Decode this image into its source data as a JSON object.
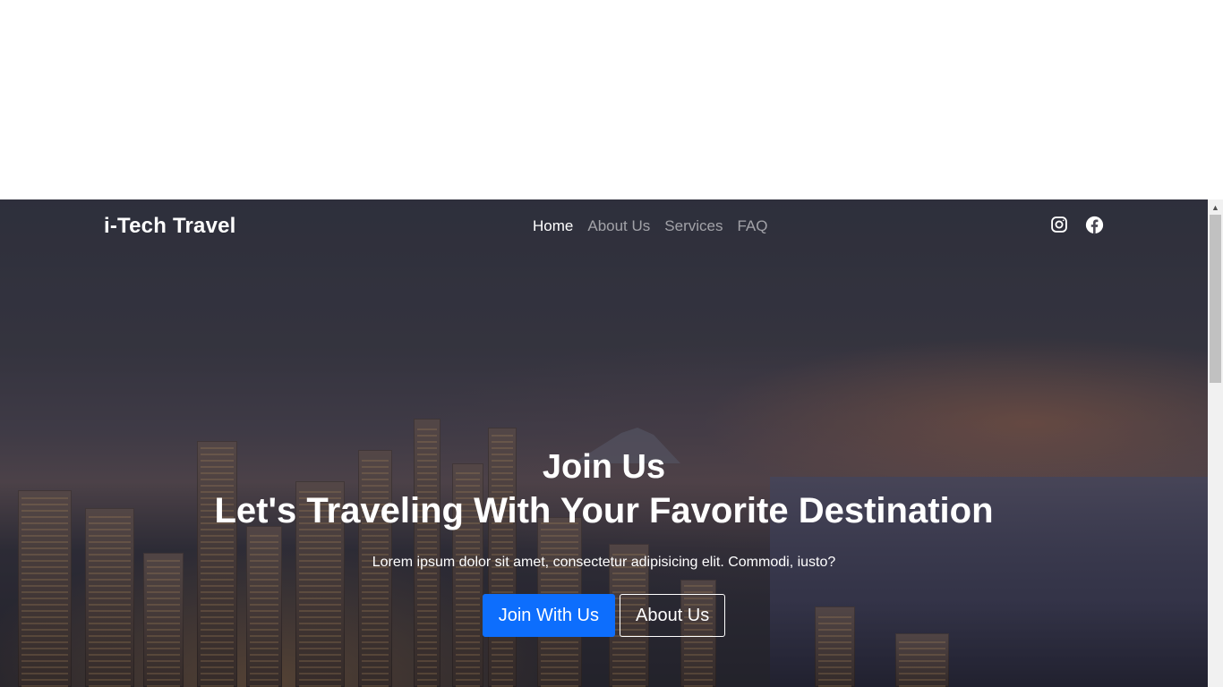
{
  "navbar": {
    "brand": "i-Tech Travel",
    "links": [
      {
        "label": "Home",
        "active": true
      },
      {
        "label": "About Us",
        "active": false
      },
      {
        "label": "Services",
        "active": false
      },
      {
        "label": "FAQ",
        "active": false
      }
    ],
    "social": [
      "instagram-icon",
      "facebook-icon"
    ]
  },
  "hero": {
    "title_line1": "Join Us",
    "title_line2": "Let's Traveling With Your Favorite Destination",
    "subtitle": "Lorem ipsum dolor sit amet, consectetur adipisicing elit. Commodi, iusto?",
    "primary_button": "Join With Us",
    "secondary_button": "About Us"
  },
  "colors": {
    "primary": "#0d6efd",
    "text": "#ffffff",
    "nav_inactive": "rgba(255,255,255,0.55)"
  }
}
